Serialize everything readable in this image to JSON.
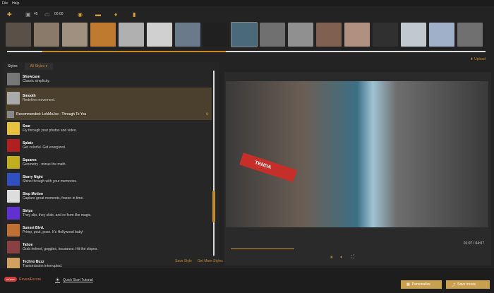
{
  "menu": [
    "File",
    "Help"
  ],
  "toolbar": {
    "photo_count": "45",
    "duration": "00:00"
  },
  "film_colors": [
    "#5a5048",
    "#8a7a6a",
    "#a09080",
    "#c07a30",
    "#b0b0b0",
    "#d0d0d0",
    "#6a7a8a",
    "#202020",
    "#4a6a7a",
    "#707070",
    "#909090",
    "#806050",
    "#b09080",
    "#303030",
    "#c0c8d0",
    "#a0b0c8",
    "#707070"
  ],
  "upload_label": "Upload",
  "styles": {
    "tab_label": "Styles",
    "filter": "All Styles",
    "items": [
      {
        "name": "Showcase",
        "desc": "Classic simplicity.",
        "color": "#777"
      },
      {
        "name": "Smooth",
        "desc": "Redefine movement.",
        "color": "#aaa"
      },
      {
        "name": "Soar",
        "desc": "Fly through your photos and video.",
        "color": "#e8c040"
      },
      {
        "name": "Splatz",
        "desc": "Get colorful. Get energized.",
        "color": "#b02020"
      },
      {
        "name": "Squares",
        "desc": "Geometry - minus the math.",
        "color": "#c0b020"
      },
      {
        "name": "Starry Night",
        "desc": "Shine through with your memories.",
        "color": "#3050c0"
      },
      {
        "name": "Stop Motion",
        "desc": "Capture great moments, frozen in time.",
        "color": "#ddd"
      },
      {
        "name": "Strips",
        "desc": "They slip, they slide, and re-form like magic.",
        "color": "#6030d0"
      },
      {
        "name": "Sunset Blvd.",
        "desc": "Primp, pout, pose. It's Hollywood baby!",
        "color": "#c07030"
      },
      {
        "name": "Tahoe",
        "desc": "Grab helmet, goggles, insurance. Hit the slopes.",
        "color": "#884040"
      },
      {
        "name": "Techno Buzz",
        "desc": "Transmission interrupted.",
        "color": "#d0a060"
      }
    ],
    "recommended": "Recommended: LehMoJoe - Through To You",
    "save_style": "Save Style",
    "get_more": "Get More Styles"
  },
  "preview": {
    "sign_text": "TENDA",
    "time": "01:07 / 04:07"
  },
  "footer": {
    "brand": "RevealExcore",
    "badge": "muvee",
    "tutorial": "Quick Start Tutorial",
    "personalize": "Personalize",
    "save_movie": "Save movie"
  }
}
